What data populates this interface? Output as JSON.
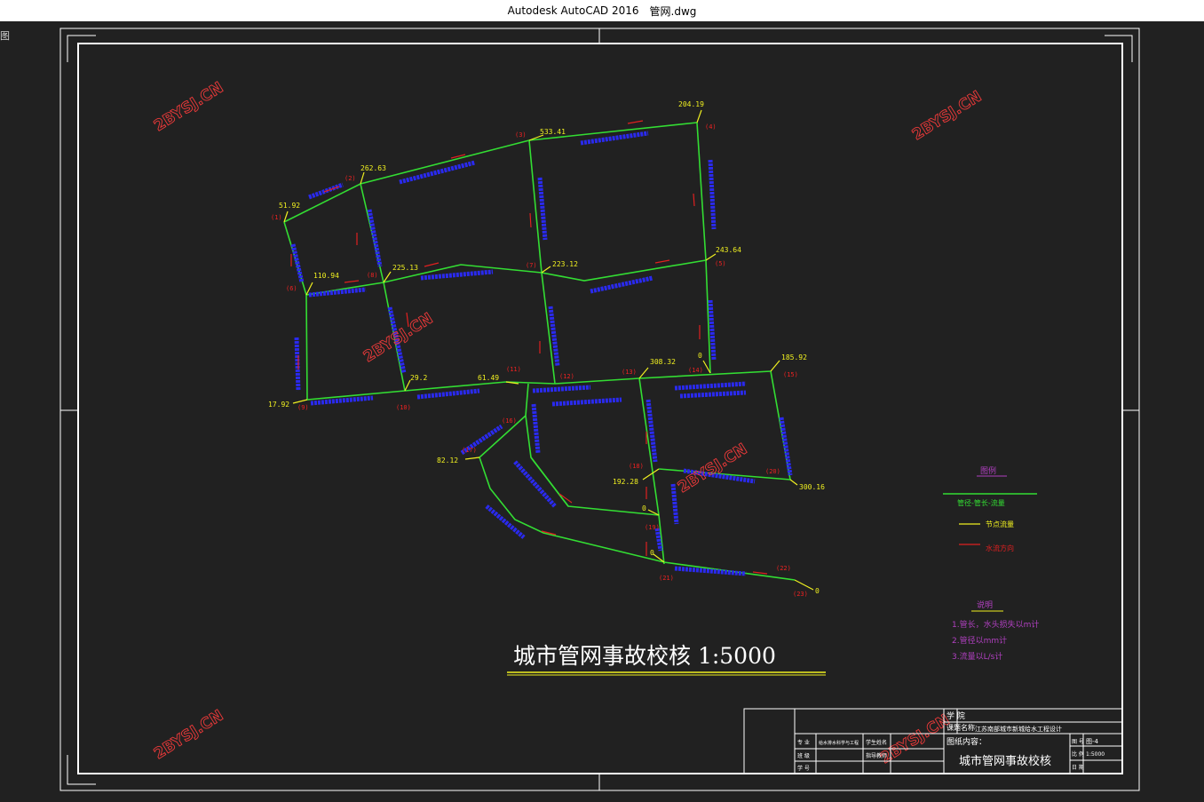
{
  "window": {
    "app": "Autodesk AutoCAD 2016",
    "file": "管网.dwg",
    "side_glyph": "图"
  },
  "drawing": {
    "main_title": "城市管网事故校核 1:5000",
    "watermark": "2BYSJ.CN",
    "node_flows": {
      "n1": "51.92",
      "n2": "262.63",
      "n3": "533.41",
      "n4": "204.19",
      "n5": "243.64",
      "n6": "110.94",
      "n7": "225.13",
      "n8": "223.12",
      "n9": "0",
      "n10": "17.92",
      "n11": "29.2",
      "n12": "61.49",
      "n13": "308.32",
      "n14": "185.92",
      "n15": "82.12",
      "n16": "192.28",
      "n17": "300.16",
      "n18": "0",
      "n19": "0",
      "n20": "0"
    },
    "node_ids": {
      "a": "(1)",
      "b": "(2)",
      "c": "(3)",
      "d": "(4)",
      "e": "(5)",
      "f": "(6)",
      "g": "(8)",
      "h": "(7)",
      "i": "(14)",
      "j": "(9)",
      "k": "(10)",
      "l": "(11)",
      "m": "(12)",
      "n": "(13)",
      "o": "(15)",
      "p": "(16)",
      "q": "(17)",
      "r": "(18)",
      "s": "(19)",
      "t": "(20)",
      "u": "(21)",
      "v": "(22)",
      "w": "(23)"
    }
  },
  "legend": {
    "title": "图例",
    "pipe_label": "管径-管长-流量",
    "node_flow_label": "节点流量",
    "flow_dir_label": "水流方向",
    "notes_title": "说明",
    "notes": [
      "1.管长，水头损失以m计",
      "2.管径以mm计",
      "3.流量以L/s计"
    ]
  },
  "title_block": {
    "school": "学 院",
    "topic_label": "课题名称",
    "topic_value": "江苏南部城市新城给水工程设计",
    "major_label": "专 业",
    "major_value": "给水排水科学与工程",
    "student_label": "学生姓名",
    "drawing_content_label": "图纸内容：",
    "drawing_content": "城市管网事故校核",
    "fig_no_label": "图 号",
    "fig_no": "图-4",
    "scale_label": "比 例",
    "scale": "1:5000",
    "date_label": "日 期",
    "class_label": "班 级",
    "student_no_label": "学 号",
    "advisor_label": "指导教师"
  },
  "colors": {
    "pipe": "#33dd33",
    "pipe_label": "#2a2aee",
    "flow_arrow": "#e02020",
    "node_id": "#ee2222",
    "node_flow": "#f0f020",
    "frame": "#ffffff",
    "legend_note": "#b040c0"
  }
}
